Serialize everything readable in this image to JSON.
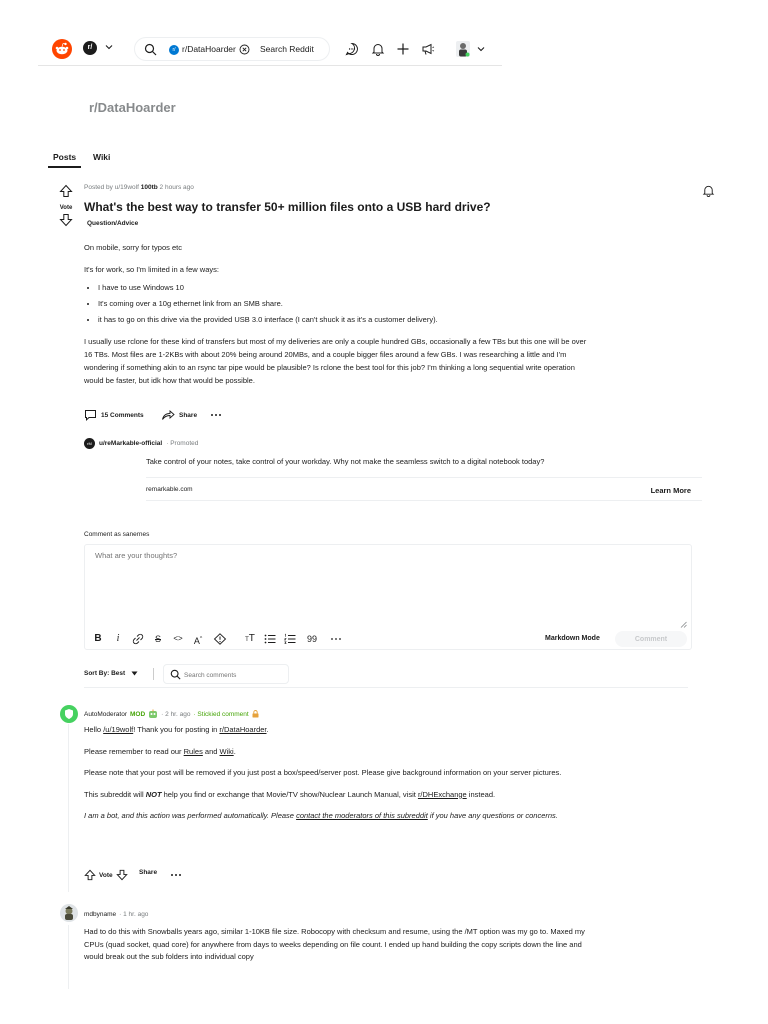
{
  "topbar": {
    "feed_badge": "r/",
    "search_chip": "r/DataHoarder",
    "search_chip_icon": "r/",
    "search_placeholder": "Search Reddit",
    "icons": [
      "reddit-logo-icon",
      "chat-icon",
      "bell-icon",
      "plus-icon",
      "megaphone-icon"
    ]
  },
  "subreddit": {
    "title": "r/DataHoarder",
    "tabs": [
      "Posts",
      "Wiki"
    ]
  },
  "post": {
    "vote_label": "Vote",
    "posted_by": "Posted by u/19wolf",
    "user_flair": "100tb",
    "time": "2 hours ago",
    "title": "What's the best way to transfer 50+ million files onto a USB hard drive?",
    "flair": "Question/Advice",
    "body_p1": "On mobile, sorry for typos etc",
    "body_p2": "It's for work, so I'm limited in a few ways:",
    "bullets": [
      "I have to use Windows 10",
      "It's coming over a 10g ethernet link from an SMB share.",
      "it has to go on this drive via the provided USB 3.0 interface (I can't shuck it as it's a customer delivery)."
    ],
    "body_p3": "I usually use rclone for these kind of transfers but most of my deliveries are only a couple hundred GBs, occasionally a few TBs but this one will be over 16 TBs. Most files are 1-2KBs with about 20% being around 20MBs, and a couple bigger files around a few GBs. I was researching a little and I'm wondering if something akin to an rsync tar pipe would be plausible? Is rclone the best tool for this job? I'm thinking a long sequential write operation would be faster, but idk how that would be possible.",
    "comments_label": "15 Comments",
    "share_label": "Share"
  },
  "promoted": {
    "user": "u/reMarkable-official",
    "tag": "· Promoted",
    "avatar_text": "rM",
    "text": "Take control of your notes, take control of your workday. Why not make the seamless switch to a digital notebook today?",
    "domain": "remarkable.com",
    "cta": "Learn More"
  },
  "comment_box": {
    "comment_as": "Comment as sanernes",
    "placeholder": "What are your thoughts?",
    "markdown_mode": "Markdown Mode",
    "submit": "Comment"
  },
  "sort": {
    "label": "Sort By: Best",
    "search_placeholder": "Search comments"
  },
  "comments": [
    {
      "user": "AutoModerator",
      "mod": "MOD",
      "time": "· 2 hr. ago",
      "sticky": "· Stickied comment",
      "p1_pre": "Hello ",
      "p1_link1": "/u/19wolf",
      "p1_mid": "! Thank you for posting in ",
      "p1_link2": "r/DataHoarder",
      "p1_post": ".",
      "p2_pre": "Please remember to read our ",
      "p2_link1": "Rules",
      "p2_mid": " and ",
      "p2_link2": "Wiki",
      "p2_post": ".",
      "p3": "Please note that your post will be removed if you just post a box/speed/server post. Please give background information on your server pictures.",
      "p4_pre": "This subreddit will ",
      "p4_bold": "NOT",
      "p4_mid": " help you find or exchange that Movie/TV show/Nuclear Launch Manual, visit ",
      "p4_link": "r/DHExchange",
      "p4_post": " instead.",
      "p5_pre": "I am a bot, and this action was performed automatically. Please ",
      "p5_link": "contact the moderators of this subreddit",
      "p5_post": " if you have any questions or concerns.",
      "vote_label": "Vote",
      "share_label": "Share"
    },
    {
      "user": "mdbyname",
      "time": "· 1 hr. ago",
      "body": "Had to do this with Snowballs years ago, similar 1-10KB file size. Robocopy with checksum and resume, using the /MT option was my go to. Maxed my CPUs (quad socket, quad core) for anywhere from days to weeks depending on file count. I ended up hand building the copy scripts down the line and would break out the sub folders into individual copy"
    }
  ],
  "colors": {
    "brand": "#ff4500",
    "mod_green": "#46a508",
    "link_blue": "#0079d3",
    "meta_gray": "#787c7e"
  }
}
